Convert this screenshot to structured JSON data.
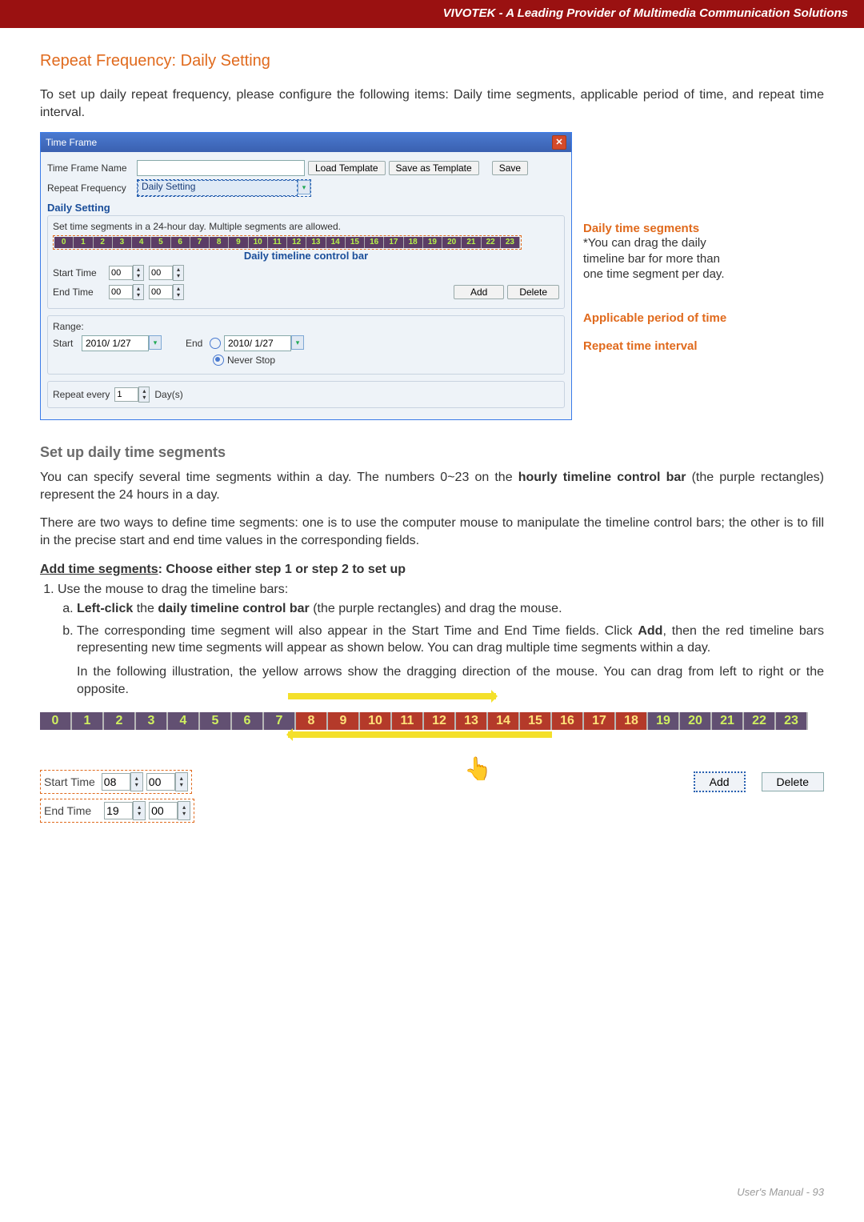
{
  "header": {
    "brand_line": "VIVOTEK - A Leading Provider of Multimedia Communication Solutions"
  },
  "section": {
    "title": "Repeat Frequency: Daily Setting",
    "intro": "To set up daily repeat frequency, please configure the following items: Daily time segments, applicable period of time, and repeat time interval."
  },
  "dialog": {
    "title": "Time Frame",
    "name_label": "Time Frame Name",
    "btn_load": "Load Template",
    "btn_saveas": "Save as Template",
    "btn_save": "Save",
    "freq_label": "Repeat Frequency",
    "freq_value": "Daily Setting",
    "subhead": "Daily Setting",
    "segments_note": "Set time segments in a 24-hour day. Multiple segments are allowed.",
    "hours": [
      "0",
      "1",
      "2",
      "3",
      "4",
      "5",
      "6",
      "7",
      "8",
      "9",
      "10",
      "11",
      "12",
      "13",
      "14",
      "15",
      "16",
      "17",
      "18",
      "19",
      "20",
      "21",
      "22",
      "23"
    ],
    "daily_bar_label": "Daily timeline control bar",
    "start_time_label": "Start Time",
    "end_time_label": "End Time",
    "spin_h": "00",
    "spin_m": "00",
    "btn_add": "Add",
    "btn_delete": "Delete",
    "range_label": "Range:",
    "range_start": "Start",
    "range_end": "End",
    "range_date": "2010/ 1/27",
    "never_stop": "Never Stop",
    "repeat_label": "Repeat every",
    "repeat_val": "1",
    "repeat_unit": "Day(s)"
  },
  "annot": {
    "a1_title": "Daily time segments",
    "a1_note": "*You can drag the daily timeline bar for more than one time segment per day.",
    "a2_title": "Applicable period of time",
    "a3_title": "Repeat time interval"
  },
  "mid": {
    "heading": "Set up daily time segments",
    "p1a": "You can specify several time segments within a day. The numbers 0~23 on the ",
    "p1b": "hourly timeline control bar",
    "p1c": " (the purple rectangles) represent the 24 hours in a day.",
    "p2": "There are two ways to define time segments: one is to use the computer mouse to manipulate the timeline control bars; the other is to fill in the precise start and end time values in the corresponding fields.",
    "addseg_label": "Add time segments",
    "addseg_rest": ": Choose either step 1 or step 2 to set up",
    "li1": "Use the mouse to drag the timeline bars:",
    "li1a_pre": "Left-click",
    "li1a_mid": " the ",
    "li1a_b2": "daily timeline control bar",
    "li1a_post": " (the purple rectangles) and drag the mouse.",
    "li1b_a": "The corresponding time segment will also appear in the Start Time and End Time fields. Click ",
    "li1b_add": "Add",
    "li1b_b": ", then the red timeline bars representing new time segments will appear as shown below. You can drag multiple time segments within a day.",
    "li1b_c": "In the following illustration, the yellow arrows show the dragging direction of the mouse. You can drag from left to right or the opposite."
  },
  "ill2": {
    "hours": [
      "0",
      "1",
      "2",
      "3",
      "4",
      "5",
      "6",
      "7",
      "8",
      "9",
      "10",
      "11",
      "12",
      "13",
      "14",
      "15",
      "16",
      "17",
      "18",
      "19",
      "20",
      "21",
      "22",
      "23"
    ],
    "start_label": "Start Time",
    "end_label": "End Time",
    "sh": "08",
    "sm": "00",
    "eh": "19",
    "em": "00",
    "btn_add": "Add",
    "btn_delete": "Delete"
  },
  "footer": {
    "text": "User's Manual - 93"
  }
}
